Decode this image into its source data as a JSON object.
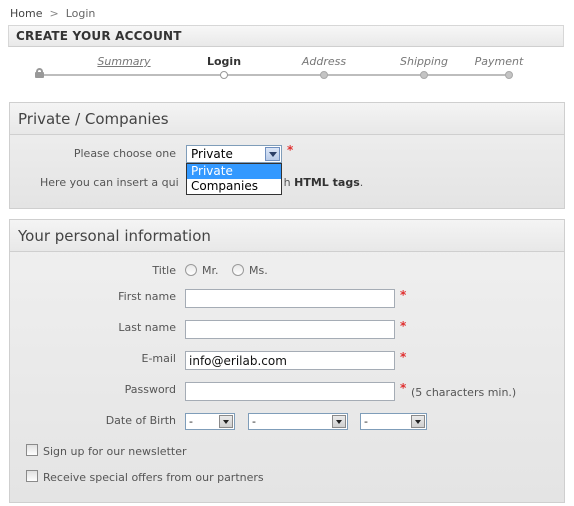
{
  "breadcrumb": {
    "home": "Home",
    "separator": ">",
    "current": "Login"
  },
  "header": {
    "title": "CREATE YOUR ACCOUNT"
  },
  "steps": [
    {
      "label": "Summary",
      "state": "link"
    },
    {
      "label": "Login",
      "state": "current"
    },
    {
      "label": "Address",
      "state": "upcoming"
    },
    {
      "label": "Shipping",
      "state": "upcoming"
    },
    {
      "label": "Payment",
      "state": "upcoming"
    }
  ],
  "private_companies": {
    "title": "Private / Companies",
    "choose_label": "Please choose one",
    "selected": "Private",
    "required_mark": "*",
    "options": [
      "Private",
      "Companies"
    ],
    "hint_before": "Here you can insert a qui",
    "hint_after_hidden": "h",
    "hint_bold": "HTML tags",
    "hint_end": "."
  },
  "personal": {
    "title": "Your personal information",
    "title_label": "Title",
    "title_options": [
      "Mr.",
      "Ms."
    ],
    "first_name_label": "First name",
    "first_name_value": "",
    "last_name_label": "Last name",
    "last_name_value": "",
    "email_label": "E-mail",
    "email_value": "info@erilab.com",
    "password_label": "Password",
    "password_value": "",
    "password_hint": "(5 characters min.)",
    "required_mark": "*",
    "dob_label": "Date of Birth",
    "dob_day": "-",
    "dob_month": "-",
    "dob_year": "-",
    "newsletter_label": "Sign up for our newsletter",
    "offers_label": "Receive special offers from our partners"
  },
  "colors": {
    "accent_required": "#e03030",
    "select_highlight": "#3399ff"
  }
}
